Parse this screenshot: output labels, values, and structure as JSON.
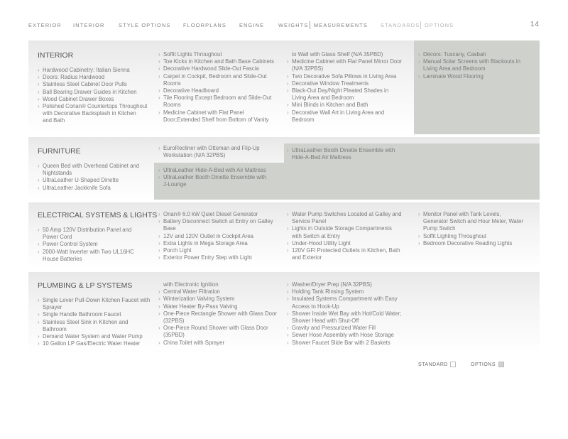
{
  "nav": {
    "exterior": "EXTERIOR",
    "interior": "INTERIOR",
    "style_options": "STYLE OPTIONS",
    "floorplans": "FLOORPLANS",
    "engine": "ENGINE",
    "weights": "WEIGHTS",
    "measurements": "MEASUREMENTS",
    "standards": "STANDARDS",
    "options": "OPTIONS"
  },
  "page_number": "14",
  "colors": {
    "options_shade": "#cfd2cc",
    "text": "#7a7a7a",
    "heading": "#555555"
  },
  "sections": {
    "interior": {
      "title": "INTERIOR",
      "col1": [
        "Hardwood Cabinetry: Italian Sienna",
        "Doors: Radius Hardwood",
        "Stainless Steel Cabinet Door Pulls",
        "Ball Bearing Drawer Guides in Kitchen",
        "Wood Cabinet Drawer Boxes",
        "Polished Corian® Countertops Throughout",
        "with Decorative Backsplash in Kitchen",
        "and Bath"
      ],
      "col2": [
        "Soffit Lights Throughout",
        "Toe Kicks in Kitchen and Bath Base Cabinets",
        "Decorative Hardwood Slide-Out Fascia",
        "Carpet in Cockpit, Bedroom and Slide-Out",
        "Rooms",
        "Decorative Headboard",
        "Tile Flooring Except Bedroom and Slide-Out",
        "Rooms",
        "Medicine Cabinet with Flat Panel",
        "Door;Extended Shelf from Bottom of Vanity"
      ],
      "col3": [
        "to Wall with Glass Shelf (N/A 35PBD)",
        "Medicine Cabinet with Flat Panel Mirror Door",
        "(N/A 32PBS)",
        "Two Decorative Sofa Pillows in Living Area",
        "Decorative Window Treatments",
        "Black-Out Day/Night Pleated Shades in",
        "Living Area and Bedroom",
        "Mini Blinds in Kitchen and Bath",
        "Decorative Wall Art in Living Area and",
        "Bedroom"
      ],
      "col4": [
        "Décors: Tuscany, Casbah",
        "Manual Solar Screens with Blackouts in",
        "Living Area and Bedroom",
        "Laminate Wood Flooring"
      ]
    },
    "furniture": {
      "title": "FURNITURE",
      "col1": [
        "Queen Bed with Overhead Cabinet and",
        "Nightstands",
        "UltraLeather U-Shaped Dinette",
        "UltraLeather Jackknife Sofa"
      ],
      "col2a": [
        "EuroRecliner with Ottoman and Flip-Up",
        "Workstation (N/A 32PBS)"
      ],
      "col2b": [
        "UltraLeather Hide-A-Bed with Air Mattress",
        "UltraLeather Booth Dinette Ensemble with",
        "J-Lounge"
      ],
      "col3": [
        "UltraLeather Booth Dinette Ensemble with",
        "Hide-A-Bed Air Mattress"
      ]
    },
    "electrical": {
      "title": "ELECTRICAL SYSTEMS & LIGHTS",
      "col1": [
        "50 Amp 120V Distribution Panel and",
        "Power Cord",
        "Power Control System",
        "2000-Watt Inverter with Two UL16HC",
        "House Batteries"
      ],
      "col2": [
        "Onan® 6.0 kW Quiet Diesel Generator",
        "Battery Disconnect Switch at Entry on Galley",
        "Base",
        "12V and 120V Outlet in Cockpit Area",
        "Extra Lights in Mega Storage Area",
        "Porch Light",
        "Exterior Power Entry Step with Light"
      ],
      "col3": [
        "Water Pump Switches Located at Galley and",
        "Service Panel",
        "Lights in Outside Storage Compartments",
        "with Switch at Entry",
        "Under-Hood Utility Light",
        "120V GFI Protected Outlets in Kitchen, Bath",
        "and Exterior"
      ],
      "col4": [
        "Monitor Panel with Tank Levels,",
        "Generator Switch and Hour Meter, Water",
        "Pump Switch",
        "Soffit Lighting Throughout",
        "Bedroom Decorative Reading Lights"
      ]
    },
    "plumbing": {
      "title": "PLUMBING & LP SYSTEMS",
      "col1": [
        "Single Lever Pull-Down Kitchen Faucet with",
        "Sprayer",
        "Single Handle Bathroom Faucet",
        "Stainless Steel Sink in Kitchen and",
        "Bathroom",
        "Demand Water System and Water Pump",
        "10 Gallon LP Gas/Electric Water Heater"
      ],
      "col2": [
        "with Electronic Ignition",
        "Central Water Filtration",
        "Winterization Valving System",
        "Water Heater By-Pass Valving",
        "One-Piece Rectangle Shower with Glass Door",
        "(32PBS)",
        "One-Piece Round Shower with Glass Door",
        "(35PBD)",
        "China Toilet with Sprayer"
      ],
      "col3": [
        "Washer/Dryer Prep (N/A 32PBS)",
        "Holding Tank Rinsing System",
        "Insulated Systems Compartment with Easy",
        "Access to Hook-Up",
        "Shower Inside Wet Bay with Hot/Cold Water;",
        "Shower Head with Shut-Off",
        "Gravity and Pressurized Water Fill",
        "Sewer Hose Assembly with Hose Storage",
        "Shower Faucet Slide Bar with 2 Baskets"
      ]
    }
  },
  "legend": {
    "standard": "STANDARD",
    "options": "OPTIONS"
  }
}
